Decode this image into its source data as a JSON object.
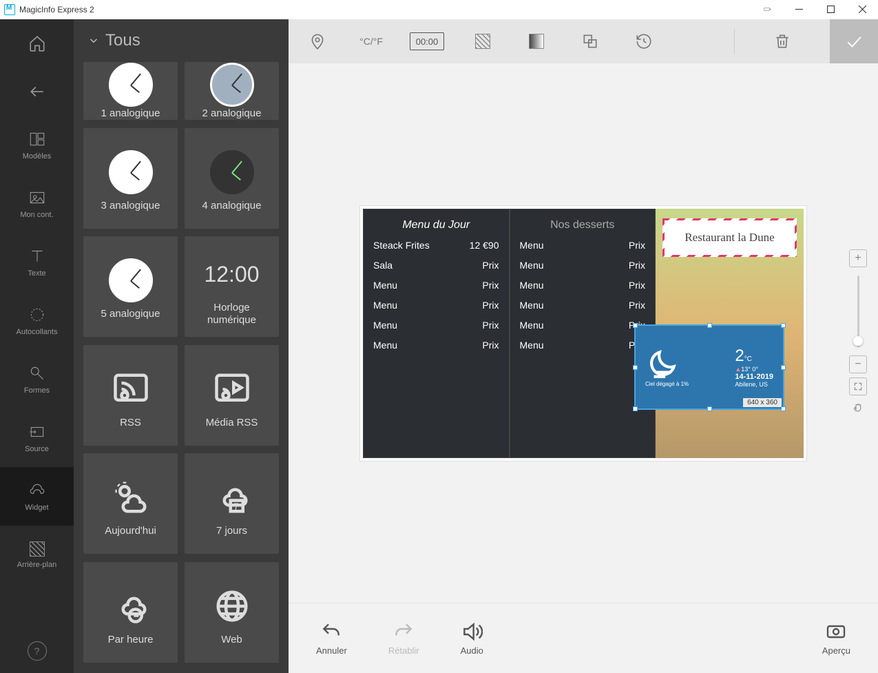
{
  "titlebar": {
    "app": "MagicInfo Express 2"
  },
  "sidebar": {
    "items": [
      {
        "label": "Modèles"
      },
      {
        "label": "Mon cont."
      },
      {
        "label": "Texte"
      },
      {
        "label": "Autocollants"
      },
      {
        "label": "Formes"
      },
      {
        "label": "Source"
      },
      {
        "label": "Widget"
      },
      {
        "label": "Arrière-plan"
      }
    ]
  },
  "library": {
    "filter": "Tous",
    "items": [
      "1 analogique",
      "2 analogique",
      "3 analogique",
      "4 analogique",
      "5 analogique",
      "Horloge numérique",
      "RSS",
      "Média RSS",
      "Aujourd'hui",
      "7 jours",
      "Par heure",
      "Web"
    ],
    "digital": "12:00"
  },
  "toolbar": {
    "time": "00:00"
  },
  "design": {
    "left": {
      "title": "Menu du Jour",
      "rows": [
        [
          "Steack Frites",
          "12 €90"
        ],
        [
          "Sala",
          "Prix"
        ],
        [
          "Menu",
          "Prix"
        ],
        [
          "Menu",
          "Prix"
        ],
        [
          "Menu",
          "Prix"
        ],
        [
          "Menu",
          "Prix"
        ]
      ]
    },
    "mid": {
      "title": "Nos desserts",
      "rows": [
        [
          "Menu",
          "Prix"
        ],
        [
          "Menu",
          "Prix"
        ],
        [
          "Menu",
          "Prix"
        ],
        [
          "Menu",
          "Prix"
        ],
        [
          "Menu",
          "Prix"
        ],
        [
          "Menu",
          "Prix"
        ]
      ]
    },
    "sign": "Restaurant la Dune"
  },
  "weather": {
    "temp": "2",
    "unit": "°C",
    "hi": "13°",
    "lo": "0°",
    "date": "14-11-2019",
    "loc": "Abilene, US",
    "desc": "Ciel dégagé à 1%",
    "dim": "640 x 360"
  },
  "bottom": {
    "undo": "Annuler",
    "redo": "Rétablir",
    "audio": "Audio",
    "preview": "Aperçu"
  },
  "cf_unit": "°C/°F"
}
